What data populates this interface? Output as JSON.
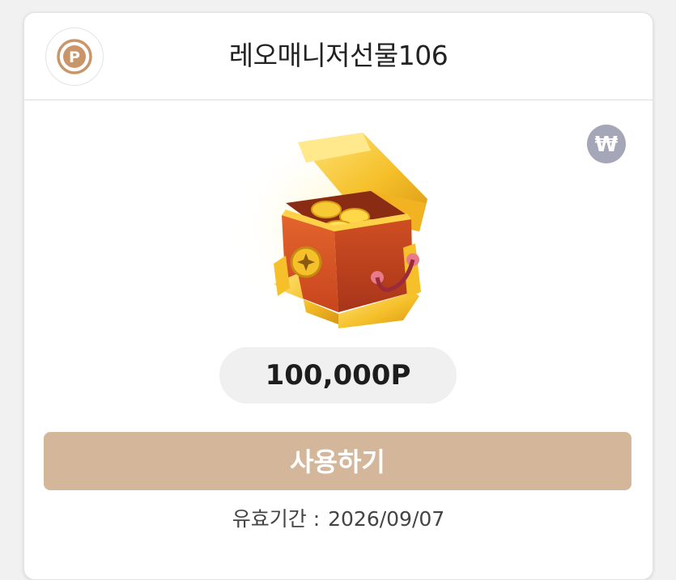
{
  "header": {
    "logo_icon": "point-coin-icon",
    "title": "레오매니저선물106"
  },
  "badge": {
    "icon": "won-icon",
    "symbol": "₩",
    "color": "#a5a6b8"
  },
  "reward": {
    "image_icon": "treasure-chest-icon",
    "amount": "100,000P"
  },
  "action": {
    "use_label": "사용하기",
    "color": "#d4b79a"
  },
  "validity": {
    "label": "유효기간 :",
    "date": "2026/09/07"
  }
}
